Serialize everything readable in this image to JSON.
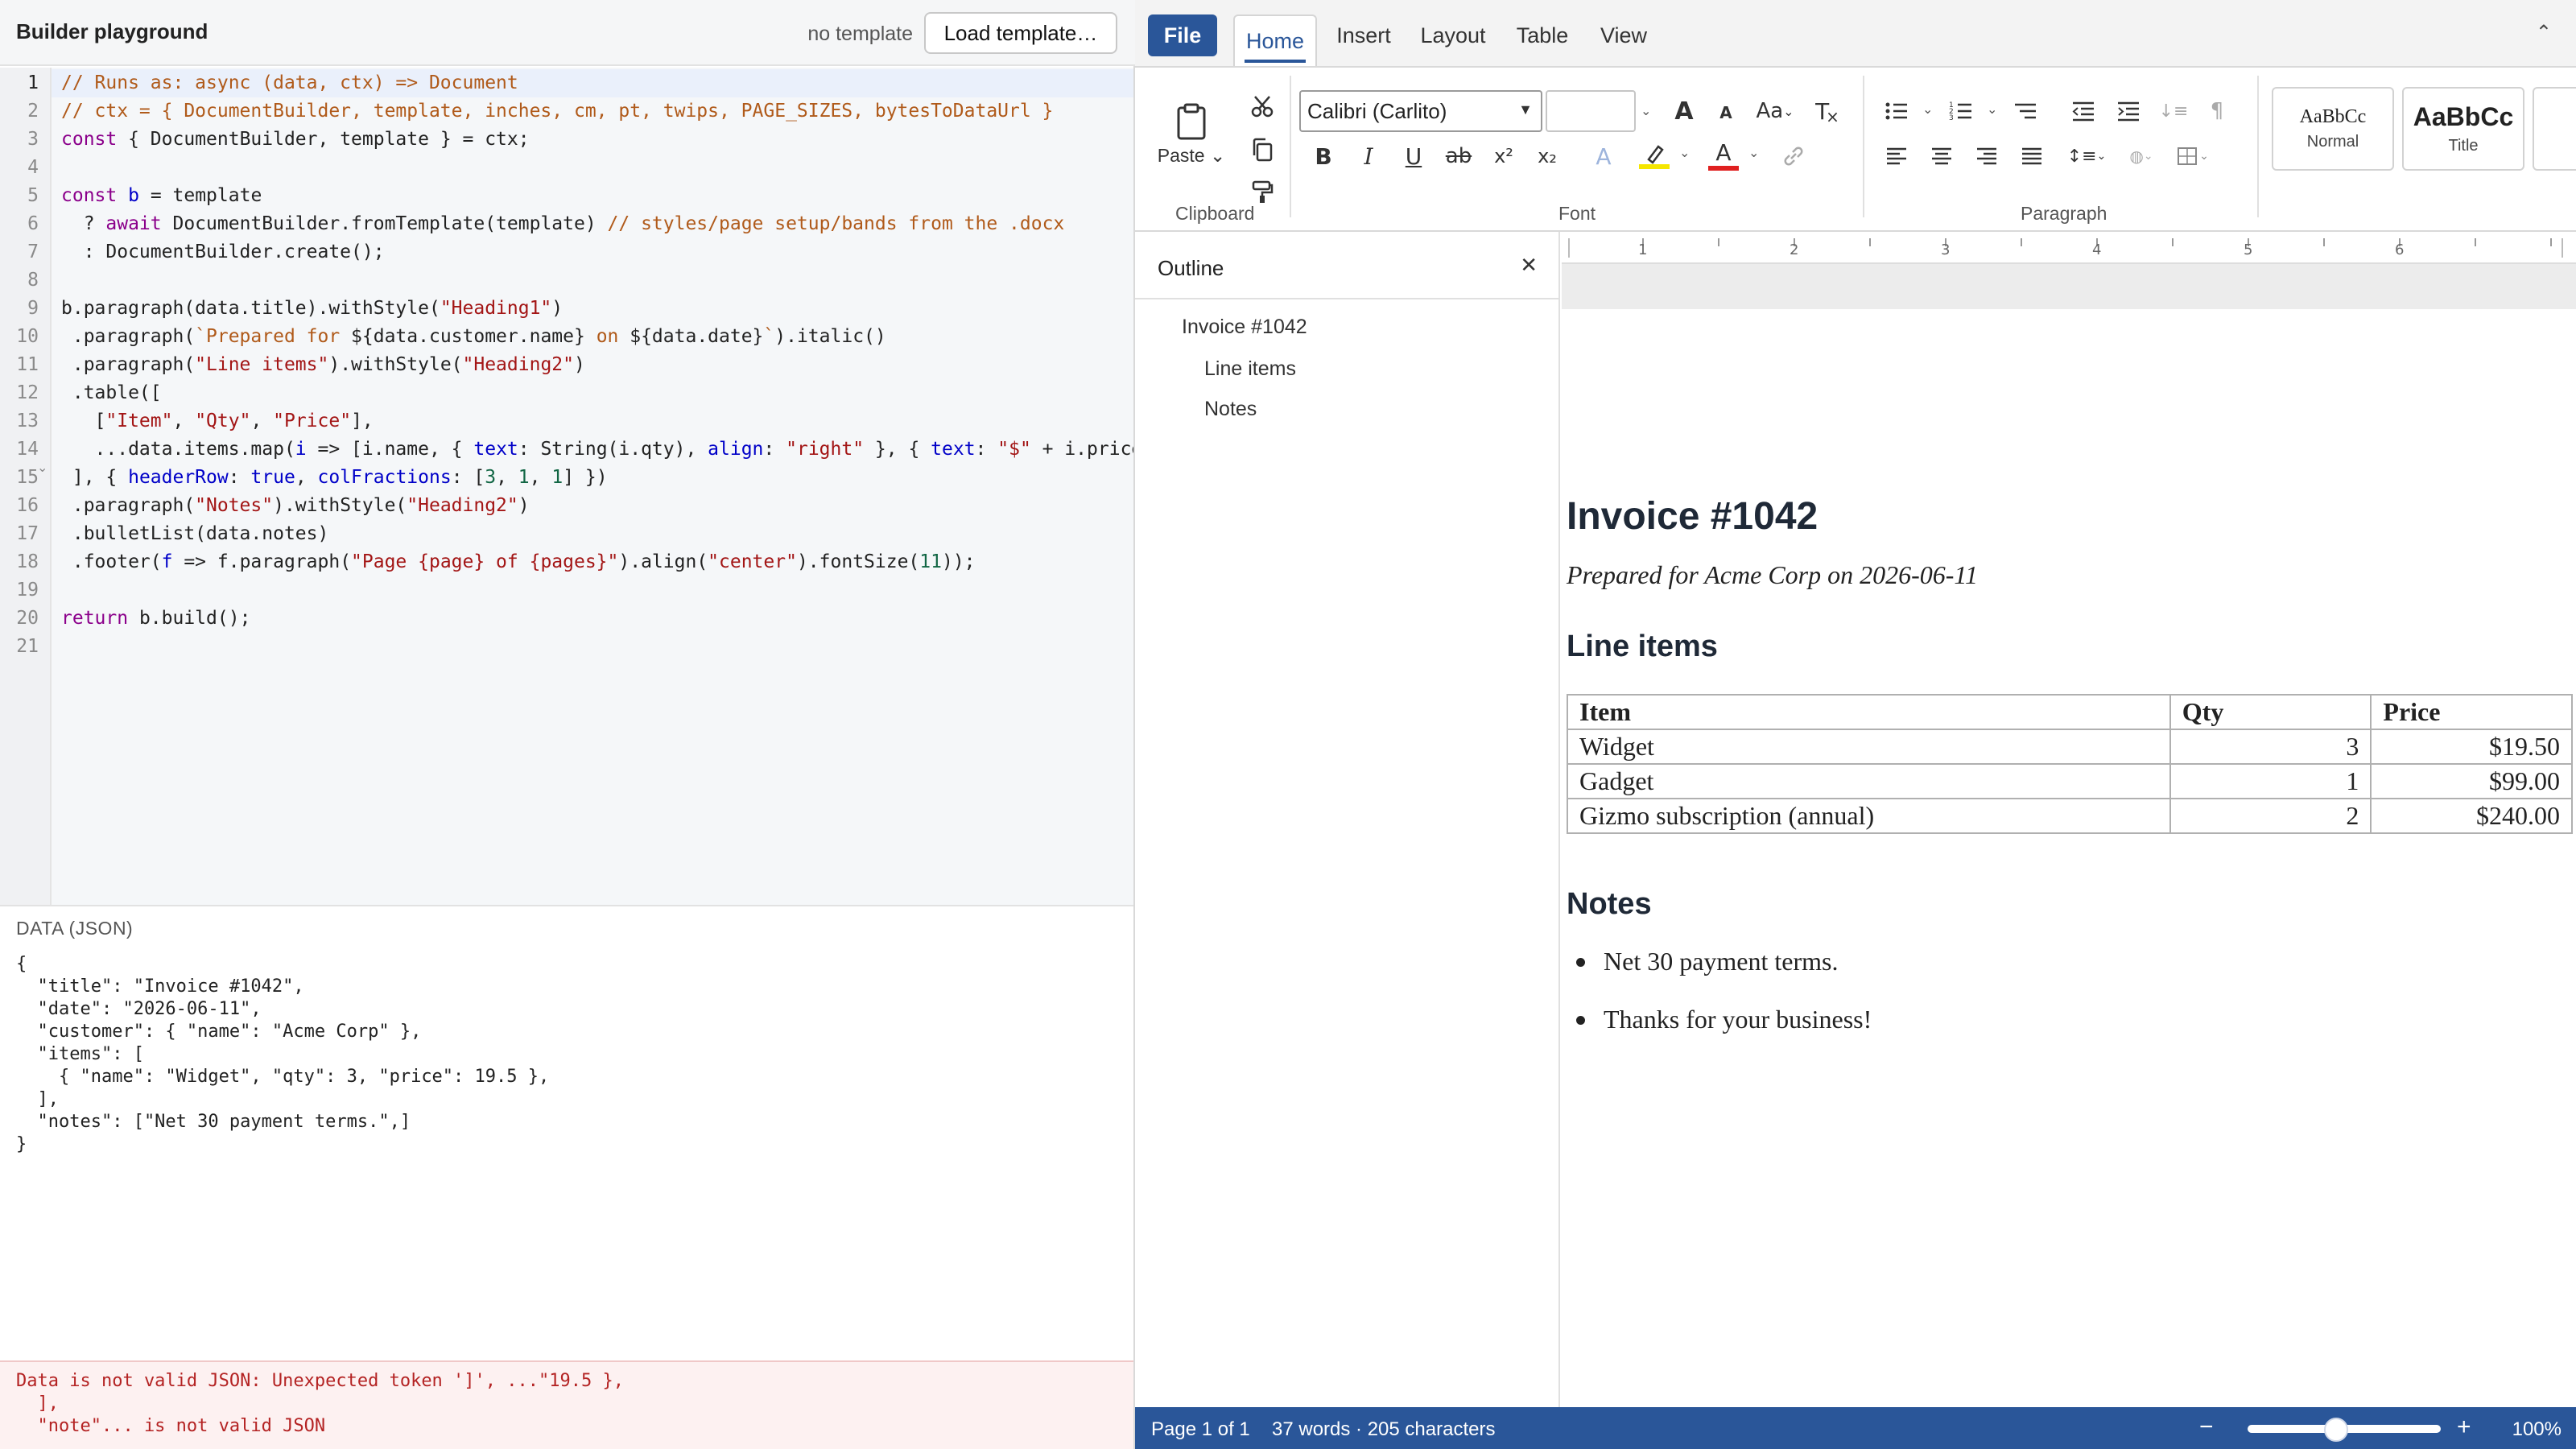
{
  "app": {
    "title": "Builder playground",
    "template_status": "no template",
    "load_template_label": "Load template…"
  },
  "editor": {
    "line_numbers": [
      "1",
      "2",
      "3",
      "4",
      "5",
      "6",
      "7",
      "8",
      "9",
      "10",
      "11",
      "12",
      "13",
      "14",
      "15",
      "16",
      "17",
      "18",
      "19",
      "20",
      "21"
    ],
    "active_line": 1,
    "folded_line": 12,
    "lines": [
      [
        {
          "t": "// Runs as: async (data, ctx) => Document",
          "c": "c"
        }
      ],
      [
        {
          "t": "// ctx = { DocumentBuilder, template, inches, cm, pt, twips, PAGE_SIZES, bytesToDataUrl }",
          "c": "c"
        }
      ],
      [
        {
          "t": "const",
          "c": "k"
        },
        {
          "t": " { DocumentBuilder, template } = ctx;",
          "c": ""
        }
      ],
      [],
      [
        {
          "t": "const",
          "c": "k"
        },
        {
          "t": " ",
          "c": ""
        },
        {
          "t": "b",
          "c": "v"
        },
        {
          "t": " = template",
          "c": ""
        }
      ],
      [
        {
          "t": "  ? ",
          "c": ""
        },
        {
          "t": "await",
          "c": "k"
        },
        {
          "t": " DocumentBuilder.fromTemplate(template) ",
          "c": ""
        },
        {
          "t": "// styles/page setup/bands from the .docx",
          "c": "c"
        }
      ],
      [
        {
          "t": "  : DocumentBuilder.create();",
          "c": ""
        }
      ],
      [],
      [
        {
          "t": "b.paragraph(data.title).withStyle(",
          "c": ""
        },
        {
          "t": "\"Heading1\"",
          "c": "s"
        },
        {
          "t": ")",
          "c": ""
        }
      ],
      [
        {
          "t": " .paragraph(",
          "c": ""
        },
        {
          "t": "`Prepared for ",
          "c": "c"
        },
        {
          "t": "${data.customer.name}",
          "c": ""
        },
        {
          "t": " on ",
          "c": "c"
        },
        {
          "t": "${data.date}",
          "c": ""
        },
        {
          "t": "`",
          "c": "c"
        },
        {
          "t": ").italic()",
          "c": ""
        }
      ],
      [
        {
          "t": " .paragraph(",
          "c": ""
        },
        {
          "t": "\"Line items\"",
          "c": "s"
        },
        {
          "t": ").withStyle(",
          "c": ""
        },
        {
          "t": "\"Heading2\"",
          "c": "s"
        },
        {
          "t": ")",
          "c": ""
        }
      ],
      [
        {
          "t": " .table([",
          "c": ""
        }
      ],
      [
        {
          "t": "   [",
          "c": ""
        },
        {
          "t": "\"Item\"",
          "c": "s"
        },
        {
          "t": ", ",
          "c": ""
        },
        {
          "t": "\"Qty\"",
          "c": "s"
        },
        {
          "t": ", ",
          "c": ""
        },
        {
          "t": "\"Price\"",
          "c": "s"
        },
        {
          "t": "],",
          "c": ""
        }
      ],
      [
        {
          "t": "   ...data.items.map(",
          "c": ""
        },
        {
          "t": "i",
          "c": "v"
        },
        {
          "t": " => [i.name, { ",
          "c": ""
        },
        {
          "t": "text",
          "c": "p"
        },
        {
          "t": ": String(i.qty), ",
          "c": ""
        },
        {
          "t": "align",
          "c": "p"
        },
        {
          "t": ": ",
          "c": ""
        },
        {
          "t": "\"right\"",
          "c": "s"
        },
        {
          "t": " }, { ",
          "c": ""
        },
        {
          "t": "text",
          "c": "p"
        },
        {
          "t": ": ",
          "c": ""
        },
        {
          "t": "\"$\"",
          "c": "s"
        },
        {
          "t": " + i.price",
          "c": ""
        }
      ],
      [
        {
          "t": " ], { ",
          "c": ""
        },
        {
          "t": "headerRow",
          "c": "p"
        },
        {
          "t": ": ",
          "c": ""
        },
        {
          "t": "true",
          "c": "v"
        },
        {
          "t": ", ",
          "c": ""
        },
        {
          "t": "colFractions",
          "c": "p"
        },
        {
          "t": ": [",
          "c": ""
        },
        {
          "t": "3",
          "c": "n"
        },
        {
          "t": ", ",
          "c": ""
        },
        {
          "t": "1",
          "c": "n"
        },
        {
          "t": ", ",
          "c": ""
        },
        {
          "t": "1",
          "c": "n"
        },
        {
          "t": "] })",
          "c": ""
        }
      ],
      [
        {
          "t": " .paragraph(",
          "c": ""
        },
        {
          "t": "\"Notes\"",
          "c": "s"
        },
        {
          "t": ").withStyle(",
          "c": ""
        },
        {
          "t": "\"Heading2\"",
          "c": "s"
        },
        {
          "t": ")",
          "c": ""
        }
      ],
      [
        {
          "t": " .bulletList(data.notes)",
          "c": ""
        }
      ],
      [
        {
          "t": " .footer(",
          "c": ""
        },
        {
          "t": "f",
          "c": "v"
        },
        {
          "t": " => f.paragraph(",
          "c": ""
        },
        {
          "t": "\"Page {page} of {pages}\"",
          "c": "s"
        },
        {
          "t": ").align(",
          "c": ""
        },
        {
          "t": "\"center\"",
          "c": "s"
        },
        {
          "t": ").fontSize(",
          "c": ""
        },
        {
          "t": "11",
          "c": "n"
        },
        {
          "t": "));",
          "c": ""
        }
      ],
      [],
      [
        {
          "t": "return",
          "c": "k"
        },
        {
          "t": " b.build();",
          "c": ""
        }
      ],
      []
    ]
  },
  "data_panel": {
    "label": "DATA (JSON)",
    "lines": [
      "{",
      "  \"title\": \"Invoice #1042\",",
      "  \"date\": \"2026-06-11\",",
      "  \"customer\": { \"name\": \"Acme Corp\" },",
      "  \"items\": [",
      "    { \"name\": \"Widget\", \"qty\": 3, \"price\": 19.5 },",
      "  ],",
      "  \"notes\": [\"Net 30 payment terms.\",]",
      "}"
    ]
  },
  "error": {
    "lines": [
      "Data is not valid JSON: Unexpected token ']', ...\"19.5 },",
      "  ],",
      "  \"note\"... is not valid JSON"
    ]
  },
  "tabs": {
    "file": "File",
    "home": "Home",
    "insert": "Insert",
    "layout": "Layout",
    "table": "Table",
    "view": "View"
  },
  "ribbon": {
    "clipboard": {
      "label": "Clipboard",
      "paste_label": "Paste"
    },
    "font": {
      "label": "Font",
      "font_name": "Calibri (Carlito)",
      "font_size": ""
    },
    "paragraph": {
      "label": "Paragraph"
    },
    "styles": [
      {
        "sample": "AaBbCc",
        "name": "Normal"
      },
      {
        "sample": "AaBbCc",
        "name": "Title"
      }
    ],
    "colors": {
      "highlight": "#f5e600",
      "font_color": "#e02020"
    }
  },
  "outline": {
    "title": "Outline",
    "items": [
      {
        "label": "Invoice #1042",
        "level": 1
      },
      {
        "label": "Line items",
        "level": 2
      },
      {
        "label": "Notes",
        "level": 2
      }
    ]
  },
  "ruler": {
    "labels": [
      "1",
      "2",
      "3",
      "4",
      "5",
      "6"
    ]
  },
  "document": {
    "title": "Invoice #1042",
    "subtitle": "Prepared for Acme Corp on 2026-06-11",
    "line_items_heading": "Line items",
    "table": {
      "headers": [
        "Item",
        "Qty",
        "Price"
      ],
      "rows": [
        [
          "Widget",
          "3",
          "$19.50"
        ],
        [
          "Gadget",
          "1",
          "$99.00"
        ],
        [
          "Gizmo subscription (annual)",
          "2",
          "$240.00"
        ]
      ]
    },
    "notes_heading": "Notes",
    "notes": [
      "Net 30 payment terms.",
      "Thanks for your business!"
    ]
  },
  "status": {
    "page": "Page 1 of 1",
    "words": "37 words · 205 characters",
    "zoom_out": "−",
    "zoom_in": "+",
    "zoom_level": "100%",
    "zoom_fraction": 0.46
  },
  "theme": {
    "accent": "#2a5699",
    "error_bg": "#fdf1f1",
    "error_text": "#b42323"
  }
}
